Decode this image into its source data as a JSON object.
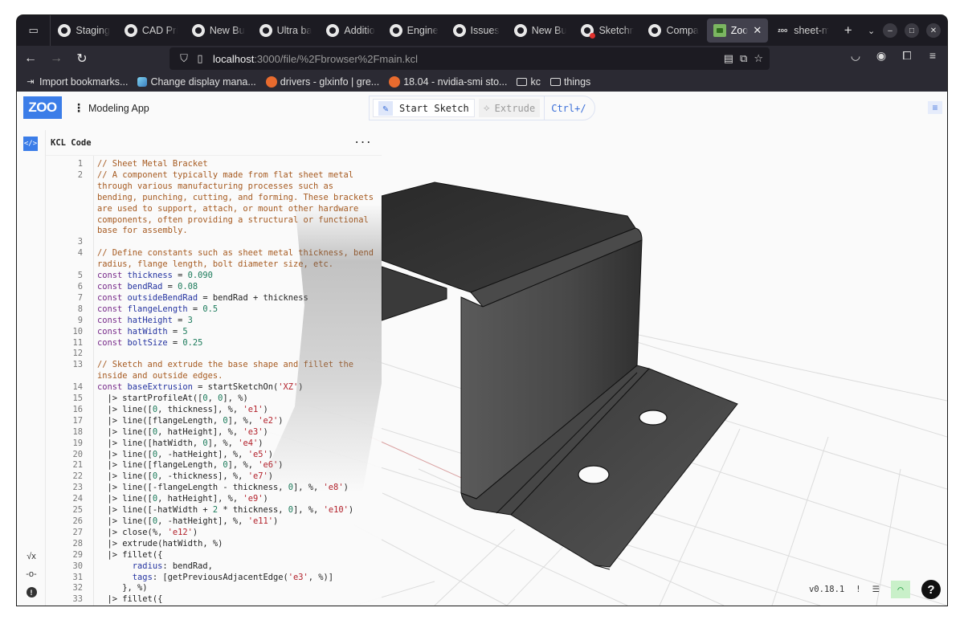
{
  "browser": {
    "tabs": [
      {
        "label": "Staging",
        "icon": "github-icon"
      },
      {
        "label": "CAD Pri",
        "icon": "github-icon"
      },
      {
        "label": "New Bu",
        "icon": "github-icon"
      },
      {
        "label": "Ultra ba",
        "icon": "github-icon"
      },
      {
        "label": "Additio",
        "icon": "github-icon"
      },
      {
        "label": "Engine",
        "icon": "github-icon"
      },
      {
        "label": "Issues",
        "icon": "github-icon"
      },
      {
        "label": "New Bu",
        "icon": "github-icon"
      },
      {
        "label": "Sketchn",
        "icon": "github-error-icon"
      },
      {
        "label": "Compa",
        "icon": "github-icon"
      },
      {
        "label": "Zoo",
        "icon": "zoo-favicon",
        "active": true
      },
      {
        "label": "sheet-m",
        "icon": "zoo-text-icon"
      }
    ],
    "new_tab": "+",
    "tab_list": "⌄",
    "window_controls": {
      "minimize": "–",
      "maximize": "□",
      "close": "✕"
    },
    "url": {
      "host": "localhost",
      "path": ":3000/file/%2Fbrowser%2Fmain.kcl"
    },
    "bookmarks": [
      {
        "label": "Import bookmarks...",
        "icon": "import-icon"
      },
      {
        "label": "Change display mana...",
        "icon": "site-icon"
      },
      {
        "label": "drivers - glxinfo | gre...",
        "icon": "askubuntu-icon"
      },
      {
        "label": "18.04 - nvidia-smi sto...",
        "icon": "askubuntu-icon"
      },
      {
        "label": "kc",
        "icon": "folder-icon"
      },
      {
        "label": "things",
        "icon": "folder-icon"
      }
    ]
  },
  "app": {
    "logo": "ZOO",
    "menu_label": "Modeling App",
    "toolbar": {
      "start_sketch": "Start Sketch",
      "extrude": "Extrude",
      "shortcut": "Ctrl+/"
    },
    "code_pane": {
      "title": "KCL Code",
      "more": "···",
      "code_icon": "</>"
    },
    "rail_bottom": [
      {
        "icon": "sqrt-icon",
        "glyph": "√x"
      },
      {
        "icon": "commit-icon",
        "glyph": "-o-"
      },
      {
        "icon": "info-icon",
        "glyph": "!"
      }
    ],
    "status": {
      "version": "v0.18.1",
      "alert": "!",
      "settings_glyph": "☰",
      "network_glyph": "◠",
      "help": "?"
    },
    "colors": {
      "accent": "#3b7de8",
      "comment": "#a65a20",
      "keyword": "#772a8a",
      "variable": "#2433a0",
      "number": "#1b7a5a",
      "string": "#b2202a",
      "model": "#3a3a3a",
      "connected": "#1a9a3a"
    }
  },
  "code_lines": [
    {
      "n": "1",
      "html": "<span class='c'>// Sheet Metal Bracket</span>"
    },
    {
      "n": "2",
      "html": "<span class='c'>// A component typically made from flat sheet metal through various manufacturing processes such as bending, punching, cutting, and forming. These brackets are used to support, attach, or mount other hardware components, often providing a structural or functional base for assembly.</span>"
    },
    {
      "n": "3",
      "html": ""
    },
    {
      "n": "4",
      "html": "<span class='c'>// Define constants such as sheet metal thickness, bend radius, flange length, bolt diameter size, etc.</span>"
    },
    {
      "n": "5",
      "html": "<span class='k'>const</span> <span class='v'>thickness</span> = <span class='n'>0.090</span>"
    },
    {
      "n": "6",
      "html": "<span class='k'>const</span> <span class='v'>bendRad</span> = <span class='n'>0.08</span>"
    },
    {
      "n": "7",
      "html": "<span class='k'>const</span> <span class='v'>outsideBendRad</span> = bendRad + thickness"
    },
    {
      "n": "8",
      "html": "<span class='k'>const</span> <span class='v'>flangeLength</span> = <span class='n'>0.5</span>"
    },
    {
      "n": "9",
      "html": "<span class='k'>const</span> <span class='v'>hatHeight</span> = <span class='n'>3</span>"
    },
    {
      "n": "10",
      "html": "<span class='k'>const</span> <span class='v'>hatWidth</span> = <span class='n'>5</span>"
    },
    {
      "n": "11",
      "html": "<span class='k'>const</span> <span class='v'>boltSize</span> = <span class='n'>0.25</span>"
    },
    {
      "n": "12",
      "html": ""
    },
    {
      "n": "13",
      "html": "<span class='c'>// Sketch and extrude the base shape and fillet the inside and outside edges.</span>"
    },
    {
      "n": "14",
      "html": "<span class='k'>const</span> <span class='v'>baseExtrusion</span> = startSketchOn(<span class='s'>'XZ'</span>)"
    },
    {
      "n": "15",
      "html": "  |&gt; startProfileAt([<span class='n'>0</span>, <span class='n'>0</span>], %)"
    },
    {
      "n": "16",
      "html": "  |&gt; line([<span class='n'>0</span>, thickness], %, <span class='s'>'e1'</span>)"
    },
    {
      "n": "17",
      "html": "  |&gt; line([flangeLength, <span class='n'>0</span>], %, <span class='s'>'e2'</span>)"
    },
    {
      "n": "18",
      "html": "  |&gt; line([<span class='n'>0</span>, hatHeight], %, <span class='s'>'e3'</span>)"
    },
    {
      "n": "19",
      "html": "  |&gt; line([hatWidth, <span class='n'>0</span>], %, <span class='s'>'e4'</span>)"
    },
    {
      "n": "20",
      "html": "  |&gt; line([<span class='n'>0</span>, -hatHeight], %, <span class='s'>'e5'</span>)"
    },
    {
      "n": "21",
      "html": "  |&gt; line([flangeLength, <span class='n'>0</span>], %, <span class='s'>'e6'</span>)"
    },
    {
      "n": "22",
      "html": "  |&gt; line([<span class='n'>0</span>, -thickness], %, <span class='s'>'e7'</span>)"
    },
    {
      "n": "23",
      "html": "  |&gt; line([-flangeLength - thickness, <span class='n'>0</span>], %, <span class='s'>'e8'</span>)"
    },
    {
      "n": "24",
      "html": "  |&gt; line([<span class='n'>0</span>, hatHeight], %, <span class='s'>'e9'</span>)"
    },
    {
      "n": "25",
      "html": "  |&gt; line([-hatWidth + <span class='n'>2</span> * thickness, <span class='n'>0</span>], %, <span class='s'>'e10'</span>)"
    },
    {
      "n": "26",
      "html": "  |&gt; line([<span class='n'>0</span>, -hatHeight], %, <span class='s'>'e11'</span>)"
    },
    {
      "n": "27",
      "html": "  |&gt; close(%, <span class='s'>'e12'</span>)"
    },
    {
      "n": "28",
      "html": "  |&gt; extrude(hatWidth, %)"
    },
    {
      "n": "29",
      "html": "  |&gt; fillet({"
    },
    {
      "n": "30",
      "html": "       <span class='v'>radius</span>: bendRad,"
    },
    {
      "n": "31",
      "html": "       <span class='v'>tags</span>: [getPreviousAdjacentEdge(<span class='s'>'e3'</span>, %)]"
    },
    {
      "n": "32",
      "html": "     }, %)"
    },
    {
      "n": "33",
      "html": "  |&gt; fillet({"
    }
  ]
}
